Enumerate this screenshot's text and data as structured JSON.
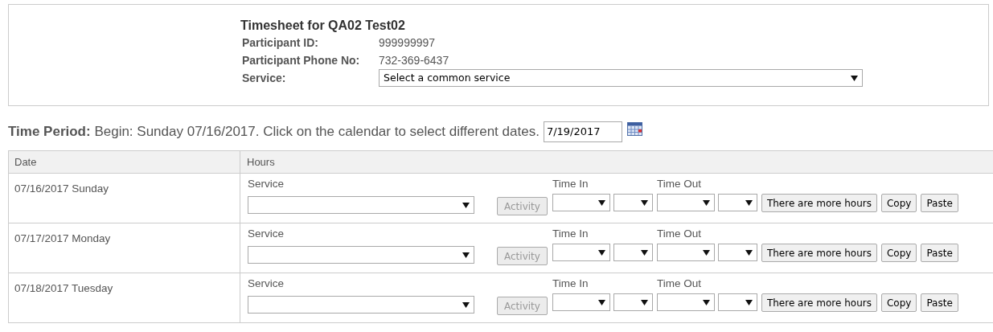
{
  "header": {
    "title": "Timesheet for QA02 Test02",
    "fields": [
      {
        "label": "Participant ID:",
        "kind": "text",
        "value": "999999997"
      },
      {
        "label": "Participant Phone No:",
        "kind": "text",
        "value": "732-369-6437"
      },
      {
        "label": "Service:",
        "kind": "select",
        "value": "Select a common service"
      }
    ]
  },
  "time_period": {
    "label": "Time Period:",
    "text": "Begin: Sunday 07/16/2017. Click on the calendar to select different dates.",
    "date": "7/19/2017"
  },
  "table": {
    "columns": [
      "Date",
      "Hours"
    ],
    "rows": [
      {
        "date": "07/16/2017 Sunday",
        "service_label": "Service",
        "activity": {
          "label": "Activity",
          "disabled": true
        },
        "time_in_label": "Time In",
        "time_out_label": "Time Out",
        "buttons": [
          "There are more hours",
          "Copy",
          "Paste"
        ]
      },
      {
        "date": "07/17/2017 Monday",
        "service_label": "Service",
        "activity": {
          "label": "Activity",
          "disabled": true
        },
        "time_in_label": "Time In",
        "time_out_label": "Time Out",
        "buttons": [
          "There are more hours",
          "Copy",
          "Paste"
        ]
      },
      {
        "date": "07/18/2017 Tuesday",
        "service_label": "Service",
        "activity": {
          "label": "Activity",
          "disabled": true
        },
        "time_in_label": "Time In",
        "time_out_label": "Time Out",
        "buttons": [
          "There are more hours",
          "Copy",
          "Paste"
        ]
      }
    ]
  }
}
